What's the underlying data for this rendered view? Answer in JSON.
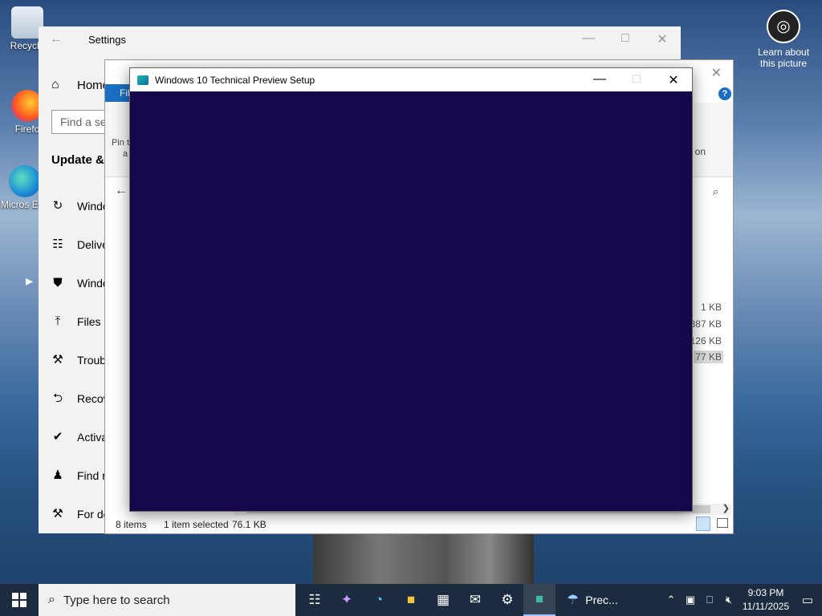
{
  "desktop": {
    "icons": [
      {
        "label": "Recycle"
      },
      {
        "label": "Firefo"
      },
      {
        "label": "Micros Edg"
      }
    ],
    "learn_label": "Learn about this picture"
  },
  "settings": {
    "title": "Settings",
    "home": "Home",
    "search_placeholder": "Find a se",
    "section": "Update & S",
    "items": [
      {
        "label": "Windo",
        "icon": "refresh-icon"
      },
      {
        "label": "Delive",
        "icon": "delivery-icon"
      },
      {
        "label": "Windo",
        "icon": "shield-icon"
      },
      {
        "label": "Files b",
        "icon": "upload-icon"
      },
      {
        "label": "Troub",
        "icon": "wrench-icon"
      },
      {
        "label": "Recov",
        "icon": "recovery-icon"
      },
      {
        "label": "Activa",
        "icon": "check-circle-icon"
      },
      {
        "label": "Find n",
        "icon": "person-pin-icon"
      },
      {
        "label": "For de",
        "icon": "tools-icon"
      }
    ]
  },
  "explorer": {
    "file_tab": "Fil",
    "ribbon_pin": "Pin t",
    "ribbon_a": "a",
    "ribbon_on": "on",
    "sizes": [
      "1 KB",
      "387 KB",
      "126 KB",
      "77 KB"
    ],
    "status_items": "8 items",
    "status_selected": "1 item selected",
    "status_size": "76.1 KB"
  },
  "setup": {
    "title": "Windows 10 Technical Preview Setup"
  },
  "taskbar": {
    "search_placeholder": "Type here to search",
    "weather_label": "Prec...",
    "time": "9:03 PM",
    "date": "11/11/2025"
  }
}
